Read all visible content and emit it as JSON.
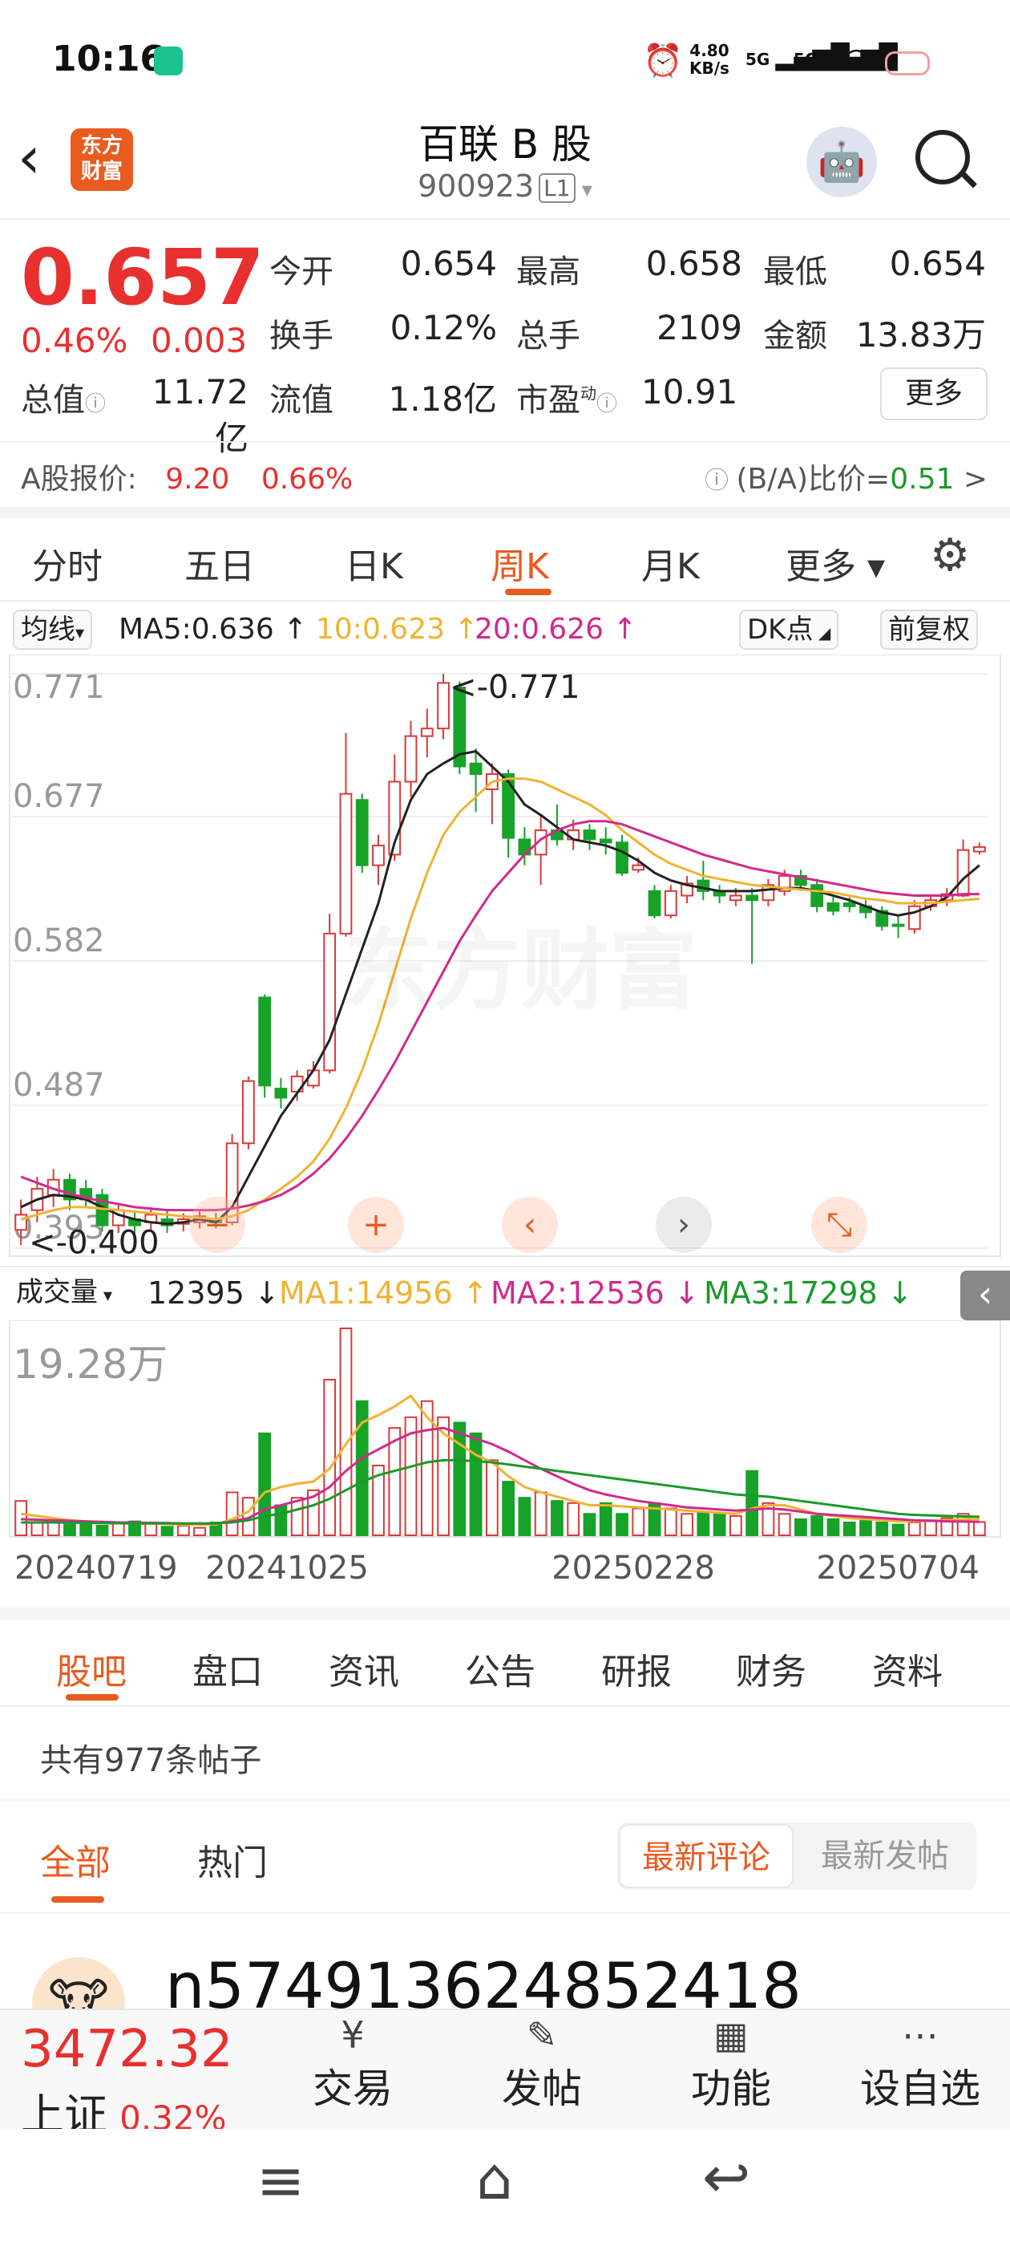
{
  "status": {
    "time": "10:16",
    "net_speed": "4.80",
    "net_unit": "KB/s",
    "sim1": "5G",
    "sim2": "5G"
  },
  "header": {
    "title": "百联 B 股",
    "code": "900923",
    "level": "L1",
    "logo_top": "东方",
    "logo_bottom": "财富"
  },
  "quote": {
    "price": "0.657",
    "change_pct": "0.46%",
    "change": "0.003",
    "open_label": "今开",
    "open": "0.654",
    "high_label": "最高",
    "high": "0.658",
    "low_label": "最低",
    "low": "0.654",
    "turnover_label": "换手",
    "turnover": "0.12%",
    "volume_label": "总手",
    "volume": "2109",
    "amount_label": "金额",
    "amount": "13.83万",
    "mktcap_label": "总值",
    "mktcap": "11.72亿",
    "float_label": "流值",
    "float": "1.18亿",
    "pe_label": "市盈",
    "pe_sup": "动",
    "pe": "10.91",
    "more": "更多"
  },
  "a_share": {
    "label": "A股报价:",
    "price": "9.20",
    "pct": "0.66%",
    "ratio_label": "(B/A)比价=",
    "ratio": "0.51",
    "arrow": ">"
  },
  "chart_tabs": [
    "分时",
    "五日",
    "日K",
    "周K",
    "月K",
    "更多"
  ],
  "chart_tab_active": 3,
  "chart_toolbar": {
    "ma_selector": "均线",
    "ma5": "MA5:0.636 ↑",
    "ma10": "10:0.623 ↑",
    "ma20": "20:0.626 ↑",
    "dk": "DK点",
    "adjust": "前复权"
  },
  "watermark": "东方财富",
  "volume_toolbar": {
    "selector": "成交量",
    "vol": "12395 ↓",
    "ma1": "MA1:14956 ↑",
    "ma2": "MA2:12536 ↓",
    "ma3": "MA3:17298 ↓"
  },
  "chart_data": [
    {
      "type": "candlestick",
      "title": "",
      "y_ticks": [
        "0.771",
        "0.677",
        "0.582",
        "0.487",
        "0.393"
      ],
      "ylim": [
        0.393,
        0.771
      ],
      "max_annotation": "<-0.771",
      "min_annotation": "<-0.400",
      "x_labels": [
        "20240719",
        "20241025",
        "20250228",
        "20250704"
      ],
      "candles": [
        {
          "o": 0.405,
          "c": 0.415,
          "h": 0.425,
          "l": 0.395
        },
        {
          "o": 0.418,
          "c": 0.432,
          "h": 0.44,
          "l": 0.41
        },
        {
          "o": 0.428,
          "c": 0.438,
          "h": 0.445,
          "l": 0.42
        },
        {
          "o": 0.438,
          "c": 0.425,
          "h": 0.442,
          "l": 0.418
        },
        {
          "o": 0.432,
          "c": 0.425,
          "h": 0.438,
          "l": 0.42
        },
        {
          "o": 0.428,
          "c": 0.408,
          "h": 0.432,
          "l": 0.404
        },
        {
          "o": 0.408,
          "c": 0.418,
          "h": 0.422,
          "l": 0.403
        },
        {
          "o": 0.412,
          "c": 0.408,
          "h": 0.418,
          "l": 0.402
        },
        {
          "o": 0.41,
          "c": 0.415,
          "h": 0.42,
          "l": 0.405
        },
        {
          "o": 0.412,
          "c": 0.408,
          "h": 0.418,
          "l": 0.403
        },
        {
          "o": 0.409,
          "c": 0.412,
          "h": 0.416,
          "l": 0.404
        },
        {
          "o": 0.41,
          "c": 0.414,
          "h": 0.418,
          "l": 0.406
        },
        {
          "o": 0.412,
          "c": 0.41,
          "h": 0.416,
          "l": 0.406
        },
        {
          "o": 0.41,
          "c": 0.462,
          "h": 0.468,
          "l": 0.408
        },
        {
          "o": 0.462,
          "c": 0.503,
          "h": 0.506,
          "l": 0.458
        },
        {
          "o": 0.558,
          "c": 0.5,
          "h": 0.56,
          "l": 0.492
        },
        {
          "o": 0.498,
          "c": 0.492,
          "h": 0.505,
          "l": 0.485
        },
        {
          "o": 0.496,
          "c": 0.506,
          "h": 0.51,
          "l": 0.49
        },
        {
          "o": 0.5,
          "c": 0.51,
          "h": 0.516,
          "l": 0.498
        },
        {
          "o": 0.51,
          "c": 0.6,
          "h": 0.613,
          "l": 0.508
        },
        {
          "o": 0.6,
          "c": 0.692,
          "h": 0.732,
          "l": 0.598
        },
        {
          "o": 0.688,
          "c": 0.645,
          "h": 0.692,
          "l": 0.64
        },
        {
          "o": 0.645,
          "c": 0.658,
          "h": 0.665,
          "l": 0.632
        },
        {
          "o": 0.652,
          "c": 0.7,
          "h": 0.718,
          "l": 0.648
        },
        {
          "o": 0.7,
          "c": 0.73,
          "h": 0.74,
          "l": 0.69
        },
        {
          "o": 0.73,
          "c": 0.735,
          "h": 0.748,
          "l": 0.716
        },
        {
          "o": 0.735,
          "c": 0.765,
          "h": 0.771,
          "l": 0.728
        },
        {
          "o": 0.762,
          "c": 0.71,
          "h": 0.766,
          "l": 0.705
        },
        {
          "o": 0.712,
          "c": 0.705,
          "h": 0.722,
          "l": 0.68
        },
        {
          "o": 0.695,
          "c": 0.705,
          "h": 0.712,
          "l": 0.672
        },
        {
          "o": 0.705,
          "c": 0.663,
          "h": 0.708,
          "l": 0.65
        },
        {
          "o": 0.662,
          "c": 0.652,
          "h": 0.67,
          "l": 0.645
        },
        {
          "o": 0.652,
          "c": 0.668,
          "h": 0.678,
          "l": 0.632
        },
        {
          "o": 0.668,
          "c": 0.662,
          "h": 0.685,
          "l": 0.658
        },
        {
          "o": 0.662,
          "c": 0.668,
          "h": 0.675,
          "l": 0.655
        },
        {
          "o": 0.668,
          "c": 0.662,
          "h": 0.672,
          "l": 0.655
        },
        {
          "o": 0.662,
          "c": 0.66,
          "h": 0.67,
          "l": 0.652
        },
        {
          "o": 0.66,
          "c": 0.64,
          "h": 0.665,
          "l": 0.638
        },
        {
          "o": 0.642,
          "c": 0.645,
          "h": 0.65,
          "l": 0.64
        },
        {
          "o": 0.628,
          "c": 0.612,
          "h": 0.632,
          "l": 0.61
        },
        {
          "o": 0.612,
          "c": 0.628,
          "h": 0.632,
          "l": 0.61
        },
        {
          "o": 0.625,
          "c": 0.633,
          "h": 0.638,
          "l": 0.62
        },
        {
          "o": 0.635,
          "c": 0.628,
          "h": 0.648,
          "l": 0.622
        },
        {
          "o": 0.628,
          "c": 0.625,
          "h": 0.632,
          "l": 0.62
        },
        {
          "o": 0.622,
          "c": 0.625,
          "h": 0.63,
          "l": 0.618
        },
        {
          "o": 0.625,
          "c": 0.622,
          "h": 0.63,
          "l": 0.58
        },
        {
          "o": 0.622,
          "c": 0.632,
          "h": 0.636,
          "l": 0.618
        },
        {
          "o": 0.628,
          "c": 0.638,
          "h": 0.642,
          "l": 0.625
        },
        {
          "o": 0.638,
          "c": 0.632,
          "h": 0.642,
          "l": 0.628
        },
        {
          "o": 0.632,
          "c": 0.618,
          "h": 0.636,
          "l": 0.614
        },
        {
          "o": 0.62,
          "c": 0.615,
          "h": 0.624,
          "l": 0.612
        },
        {
          "o": 0.62,
          "c": 0.618,
          "h": 0.624,
          "l": 0.614
        },
        {
          "o": 0.618,
          "c": 0.614,
          "h": 0.622,
          "l": 0.61
        },
        {
          "o": 0.615,
          "c": 0.605,
          "h": 0.618,
          "l": 0.602
        },
        {
          "o": 0.606,
          "c": 0.605,
          "h": 0.612,
          "l": 0.597
        },
        {
          "o": 0.603,
          "c": 0.618,
          "h": 0.622,
          "l": 0.6
        },
        {
          "o": 0.618,
          "c": 0.622,
          "h": 0.626,
          "l": 0.615
        },
        {
          "o": 0.622,
          "c": 0.626,
          "h": 0.63,
          "l": 0.618
        },
        {
          "o": 0.625,
          "c": 0.655,
          "h": 0.662,
          "l": 0.624
        },
        {
          "o": 0.654,
          "c": 0.657,
          "h": 0.66,
          "l": 0.652
        }
      ],
      "ma_series": [
        {
          "name": "MA5",
          "color": "#222222",
          "values": [
            0.42,
            0.425,
            0.428,
            0.427,
            0.425,
            0.42,
            0.415,
            0.412,
            0.41,
            0.409,
            0.41,
            0.412,
            0.41,
            0.42,
            0.44,
            0.46,
            0.48,
            0.495,
            0.51,
            0.53,
            0.56,
            0.59,
            0.62,
            0.66,
            0.688,
            0.705,
            0.712,
            0.718,
            0.72,
            0.71,
            0.7,
            0.685,
            0.678,
            0.67,
            0.662,
            0.66,
            0.658,
            0.654,
            0.648,
            0.64,
            0.635,
            0.632,
            0.63,
            0.628,
            0.628,
            0.628,
            0.629,
            0.63,
            0.63,
            0.628,
            0.625,
            0.622,
            0.618,
            0.614,
            0.612,
            0.614,
            0.618,
            0.624,
            0.636,
            0.645
          ]
        },
        {
          "name": "MA10",
          "color": "#f0b232",
          "values": [
            0.412,
            0.415,
            0.418,
            0.42,
            0.42,
            0.419,
            0.418,
            0.417,
            0.416,
            0.415,
            0.414,
            0.413,
            0.412,
            0.414,
            0.418,
            0.425,
            0.432,
            0.44,
            0.45,
            0.465,
            0.485,
            0.51,
            0.54,
            0.575,
            0.61,
            0.64,
            0.665,
            0.68,
            0.69,
            0.7,
            0.702,
            0.702,
            0.7,
            0.695,
            0.69,
            0.685,
            0.678,
            0.668,
            0.66,
            0.652,
            0.646,
            0.642,
            0.638,
            0.636,
            0.634,
            0.632,
            0.631,
            0.63,
            0.629,
            0.628,
            0.627,
            0.625,
            0.623,
            0.622,
            0.62,
            0.62,
            0.62,
            0.621,
            0.622,
            0.623
          ]
        },
        {
          "name": "MA20",
          "color": "#d02a8c",
          "values": [
            0.44,
            0.436,
            0.432,
            0.429,
            0.426,
            0.424,
            0.422,
            0.42,
            0.419,
            0.418,
            0.418,
            0.418,
            0.418,
            0.419,
            0.421,
            0.424,
            0.428,
            0.434,
            0.442,
            0.452,
            0.465,
            0.48,
            0.497,
            0.515,
            0.535,
            0.555,
            0.575,
            0.595,
            0.612,
            0.628,
            0.64,
            0.652,
            0.662,
            0.668,
            0.672,
            0.674,
            0.674,
            0.672,
            0.668,
            0.664,
            0.66,
            0.656,
            0.652,
            0.649,
            0.646,
            0.643,
            0.641,
            0.639,
            0.637,
            0.635,
            0.633,
            0.631,
            0.629,
            0.627,
            0.626,
            0.625,
            0.625,
            0.625,
            0.626,
            0.626
          ]
        }
      ]
    },
    {
      "type": "bar",
      "title": "",
      "y_ticks": [
        "19.28万"
      ],
      "ylim": [
        0,
        192800
      ],
      "values": [
        32000,
        12000,
        14000,
        10000,
        12000,
        9000,
        11000,
        13000,
        12000,
        8000,
        9000,
        7000,
        12000,
        40000,
        35000,
        95000,
        28000,
        35000,
        42000,
        145000,
        192800,
        125000,
        65000,
        100000,
        110000,
        125000,
        110000,
        105000,
        95000,
        70000,
        50000,
        35000,
        40000,
        32000,
        30000,
        20000,
        30000,
        20000,
        25000,
        30000,
        25000,
        20000,
        22000,
        20000,
        18000,
        60000,
        30000,
        20000,
        15000,
        18000,
        15000,
        12000,
        14000,
        12000,
        10000,
        12000,
        14000,
        16000,
        20000,
        12395
      ],
      "ma_series": [
        {
          "name": "MA1",
          "color": "#f0b232",
          "values": [
            20000,
            18000,
            16000,
            14000,
            13000,
            12000,
            11500,
            11000,
            11000,
            10500,
            10000,
            10000,
            10000,
            15000,
            22000,
            40000,
            45000,
            48000,
            50000,
            62000,
            85000,
            105000,
            112000,
            120000,
            130000,
            110000,
            95000,
            85000,
            75000,
            68000,
            55000,
            45000,
            40000,
            36000,
            32000,
            28000,
            28000,
            27000,
            26000,
            25000,
            24000,
            23000,
            22000,
            21000,
            20000,
            25000,
            28000,
            28000,
            24000,
            20000,
            18000,
            16000,
            15000,
            14000,
            13000,
            13000,
            13500,
            14000,
            15000,
            14956
          ]
        },
        {
          "name": "MA2",
          "color": "#d02a8c",
          "values": [
            15000,
            14500,
            14000,
            13500,
            13000,
            12500,
            12000,
            12000,
            11500,
            11500,
            11000,
            11000,
            11000,
            13000,
            16000,
            24000,
            28000,
            32000,
            36000,
            45000,
            60000,
            72000,
            80000,
            88000,
            95000,
            98000,
            100000,
            95000,
            90000,
            85000,
            78000,
            70000,
            62000,
            55000,
            48000,
            42000,
            38000,
            35000,
            32000,
            30000,
            28000,
            26000,
            25000,
            24000,
            23000,
            24000,
            25000,
            24000,
            22000,
            20000,
            19000,
            18000,
            17000,
            16000,
            15000,
            14000,
            13500,
            13000,
            12800,
            12536
          ]
        },
        {
          "name": "MA3",
          "color": "#1a9a2a",
          "values": [
            12000,
            12000,
            12000,
            11800,
            11600,
            11400,
            11200,
            11000,
            11000,
            11000,
            11000,
            11000,
            11000,
            12000,
            14000,
            18000,
            20000,
            24000,
            28000,
            34000,
            42000,
            50000,
            56000,
            60000,
            64000,
            68000,
            70000,
            70000,
            69000,
            68000,
            66000,
            64000,
            62000,
            60000,
            58000,
            56000,
            54000,
            52000,
            50000,
            48000,
            46000,
            44000,
            42000,
            40000,
            38000,
            37000,
            36000,
            34000,
            32000,
            30000,
            28000,
            26000,
            24000,
            22000,
            20000,
            19000,
            18500,
            18000,
            17600,
            17298
          ]
        }
      ]
    }
  ],
  "chart_controls": {
    "minus": "−",
    "plus": "+",
    "prev": "‹",
    "next": "›",
    "expand": "⤡",
    "collapse": "‹"
  },
  "section_tabs": [
    "股吧",
    "盘口",
    "资讯",
    "公告",
    "研报",
    "财务",
    "资料"
  ],
  "section_active": 0,
  "post_count": "共有977条帖子",
  "filters": {
    "all": "全部",
    "hot": "热门",
    "latest_comment": "最新评论",
    "latest_post": "最新发帖"
  },
  "first_post": {
    "username": "n574913624852418"
  },
  "bottom_bar": {
    "index_value": "3472.32",
    "index_name": "上证",
    "index_pct": "0.32%",
    "items": [
      {
        "label": "交易",
        "icon": "¥"
      },
      {
        "label": "发帖",
        "icon": "✎"
      },
      {
        "label": "功能",
        "icon": "▦"
      },
      {
        "label": "设自选",
        "icon": "⋯"
      }
    ]
  },
  "system_nav": {
    "menu": "≡",
    "home": "⌂",
    "back": "↩"
  }
}
